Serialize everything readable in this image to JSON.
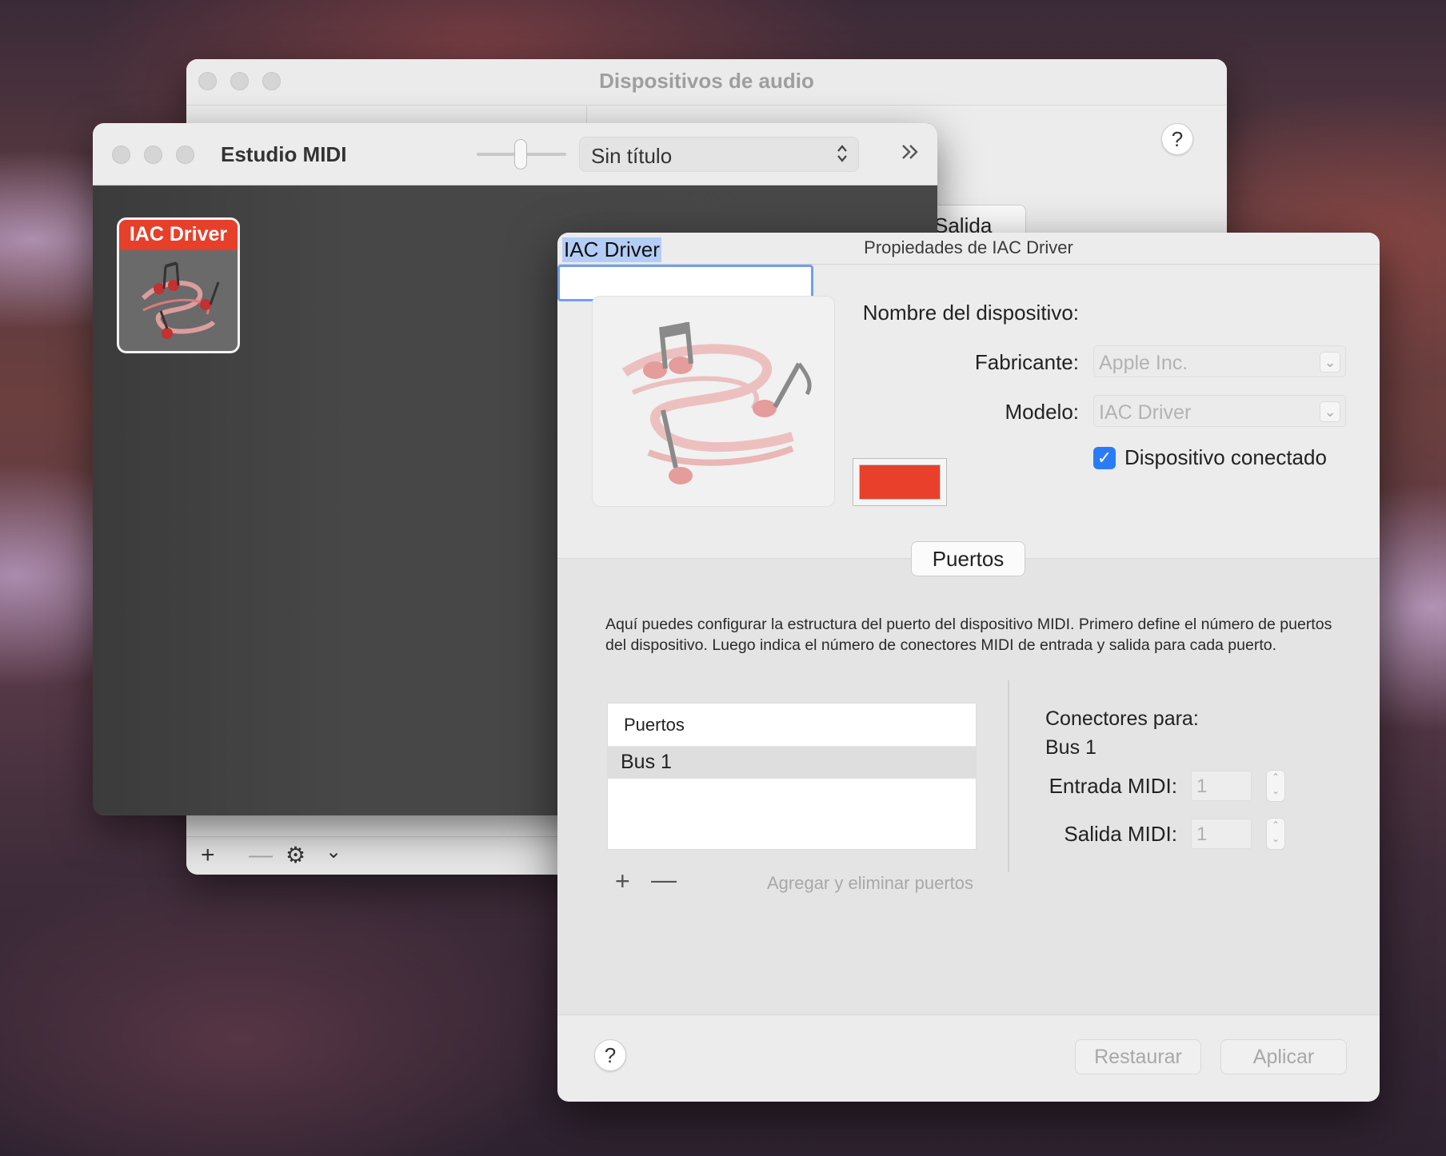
{
  "audio_window": {
    "title": "Dispositivos de audio",
    "tab_salida": "Salida",
    "help": "?",
    "bottom_add": "+",
    "bottom_remove": "—",
    "bottom_gear": "⚙",
    "bottom_chevron": "⌄"
  },
  "midi_window": {
    "title": "Estudio MIDI",
    "config_popup": "Sin título",
    "popup_arrows": "⌃⌄",
    "more": "»",
    "device_label": "IAC Driver"
  },
  "props": {
    "title": "Propiedades de IAC Driver",
    "name_label": "Nombre del dispositivo:",
    "name_value": "IAC Driver",
    "manufacturer_label": "Fabricante:",
    "manufacturer_value": "Apple Inc.",
    "model_label": "Modelo:",
    "model_value": "IAC Driver",
    "connected_label": "Dispositivo conectado",
    "connected_checked": true,
    "color": "#e8402a",
    "tab_label": "Puertos",
    "description": "Aquí puedes configurar la estructura del puerto del dispositivo MIDI. Primero define el número de puertos del dispositivo. Luego indica el número de conectores MIDI de entrada y salida para cada puerto.",
    "ports_header": "Puertos",
    "ports": [
      "Bus 1"
    ],
    "add": "+",
    "remove": "—",
    "add_remove_label": "Agregar y eliminar puertos",
    "connectors_title": "Conectores para:",
    "connectors_port": "Bus 1",
    "midi_in_label": "Entrada MIDI:",
    "midi_in_value": "1",
    "midi_out_label": "Salida MIDI:",
    "midi_out_value": "1",
    "help": "?",
    "restore_label": "Restaurar",
    "apply_label": "Aplicar"
  }
}
